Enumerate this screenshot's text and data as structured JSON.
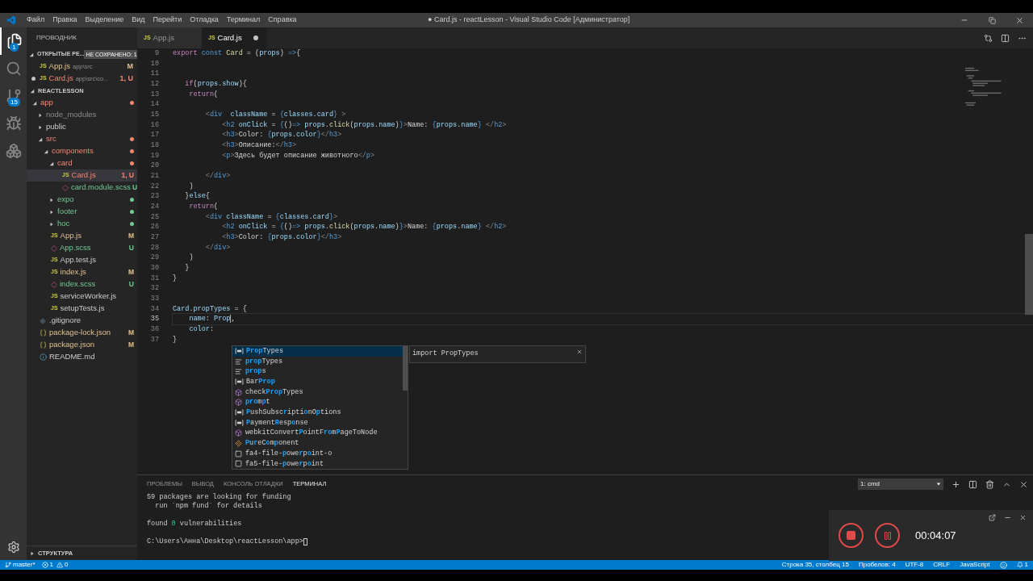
{
  "menu": [
    "Файл",
    "Правка",
    "Выделение",
    "Вид",
    "Перейти",
    "Отладка",
    "Терминал",
    "Справка"
  ],
  "window": {
    "title": "● Card.js - reactLesson - Visual Studio Code [Администратор]"
  },
  "activity": [
    {
      "kind": "files",
      "badge": "1",
      "selected": true
    },
    {
      "kind": "search",
      "selected": false
    },
    {
      "kind": "git",
      "badge": "15",
      "selected": false
    },
    {
      "kind": "debug",
      "selected": false
    },
    {
      "kind": "extensions",
      "selected": false
    }
  ],
  "sidebar": {
    "title": "ПРОВОДНИК",
    "open_editors": {
      "title": "ОТКРЫТЫЕ РЕ...",
      "badge": "НЕ СОХРАНЕНО: 1",
      "items": [
        {
          "icon": "JS",
          "name": "App.js",
          "path": "app\\src",
          "status": "M",
          "color": "#e2c08d",
          "dirty": false
        },
        {
          "icon": "JS",
          "name": "Card.js",
          "path": "app\\src\\co...",
          "status": "1, U",
          "color": "#f48771",
          "dirty": true
        }
      ]
    },
    "project": "REACTLESSON",
    "tree": [
      {
        "name": "app",
        "kind": "folder",
        "expanded": true,
        "color": "#f48771",
        "dot": true,
        "selected": false,
        "children": [
          {
            "name": "node_modules",
            "kind": "folder",
            "expanded": false,
            "ignored": true,
            "dot": false,
            "selected": false
          },
          {
            "name": "public",
            "kind": "folder",
            "expanded": false,
            "ignored": false,
            "dot": false,
            "selected": false
          },
          {
            "name": "src",
            "kind": "folder",
            "expanded": true,
            "color": "#f48771",
            "dot": true,
            "selected": false,
            "children": [
              {
                "name": "components",
                "kind": "folder",
                "expanded": true,
                "color": "#f48771",
                "dot": true,
                "selected": false,
                "children": [
                  {
                    "name": "card",
                    "kind": "folder",
                    "expanded": true,
                    "color": "#f48771",
                    "dot": true,
                    "selected": false,
                    "children": [
                      {
                        "name": "Card.js",
                        "kind": "js",
                        "icon": "JS",
                        "status": "1, U",
                        "color": "#f48771",
                        "selected": true
                      },
                      {
                        "name": "card.module.scss",
                        "kind": "scss",
                        "status": "U",
                        "color": "#73c991",
                        "selected": false
                      }
                    ]
                  },
                  {
                    "name": "expo",
                    "kind": "folder",
                    "expanded": false,
                    "color": "#73c991",
                    "dot": true,
                    "selected": false
                  },
                  {
                    "name": "footer",
                    "kind": "folder",
                    "expanded": false,
                    "color": "#73c991",
                    "dot": true,
                    "selected": false
                  },
                  {
                    "name": "hoc",
                    "kind": "folder",
                    "expanded": false,
                    "color": "#73c991",
                    "dot": true,
                    "selected": false
                  }
                ]
              },
              {
                "name": "App.js",
                "kind": "js",
                "icon": "JS",
                "status": "M",
                "color": "#e2c08d",
                "selected": false
              },
              {
                "name": "App.scss",
                "kind": "scss",
                "status": "U",
                "color": "#73c991",
                "selected": false
              },
              {
                "name": "App.test.js",
                "kind": "js",
                "icon": "JS",
                "selected": false
              },
              {
                "name": "index.js",
                "kind": "js",
                "icon": "JS",
                "status": "M",
                "color": "#e2c08d",
                "selected": false
              },
              {
                "name": "index.scss",
                "kind": "scss",
                "status": "U",
                "color": "#73c991",
                "selected": false
              },
              {
                "name": "serviceWorker.js",
                "kind": "js",
                "icon": "JS",
                "selected": false
              },
              {
                "name": "setupTests.js",
                "kind": "js",
                "icon": "JS",
                "selected": false
              }
            ]
          }
        ]
      },
      {
        "name": ".gitignore",
        "kind": "git",
        "selected": false
      },
      {
        "name": "package-lock.json",
        "kind": "json",
        "status": "M",
        "color": "#e2c08d",
        "selected": false
      },
      {
        "name": "package.json",
        "kind": "json",
        "status": "M",
        "color": "#e2c08d",
        "selected": false
      },
      {
        "name": "README.md",
        "kind": "info",
        "selected": false
      }
    ],
    "outline": "СТРУКТУРА"
  },
  "tabs": [
    {
      "icon": "JS",
      "label": "App.js",
      "selected": false,
      "dirty": false
    },
    {
      "icon": "JS",
      "label": "Card.js",
      "selected": true,
      "dirty": true
    }
  ],
  "code": [
    {
      "n": "9",
      "current": false,
      "text": "export const Card = (props) =>{"
    },
    {
      "n": "10",
      "current": false
    },
    {
      "n": "11",
      "current": false
    },
    {
      "n": "12",
      "current": false,
      "text": "   if(props.show){"
    },
    {
      "n": "13",
      "current": false,
      "text": "    return("
    },
    {
      "n": "14",
      "current": false
    },
    {
      "n": "15",
      "current": false,
      "text": "        <div  className = {classes.card} >"
    },
    {
      "n": "16",
      "current": false,
      "text": "            <h2 onClick = {()=> props.click(props.name)}>Name: {props.name} </h2>"
    },
    {
      "n": "17",
      "current": false,
      "text": "            <h3>Color: {props.color}</h3>"
    },
    {
      "n": "18",
      "current": false,
      "text": "            <h3>Описание:</h3>"
    },
    {
      "n": "19",
      "current": false,
      "text": "            <p>Здесь будет описание животного</p>"
    },
    {
      "n": "20",
      "current": false
    },
    {
      "n": "21",
      "current": false,
      "text": "        </div>"
    },
    {
      "n": "22",
      "current": false,
      "text": "    )"
    },
    {
      "n": "23",
      "current": false,
      "text": "   }else{"
    },
    {
      "n": "24",
      "current": false,
      "text": "    return("
    },
    {
      "n": "25",
      "current": false,
      "text": "        <div className = {classes.card}>"
    },
    {
      "n": "26",
      "current": false,
      "text": "            <h2 onClick = {()=> props.click(props.name)}>Name: {props.name} </h2>"
    },
    {
      "n": "27",
      "current": false,
      "text": "            <h3>Color: {props.color}</h3>"
    },
    {
      "n": "28",
      "current": false,
      "text": "        </div>"
    },
    {
      "n": "29",
      "current": false,
      "text": "    )"
    },
    {
      "n": "30",
      "current": false,
      "text": "   }"
    },
    {
      "n": "31",
      "current": false,
      "text": "}"
    },
    {
      "n": "32",
      "current": false
    },
    {
      "n": "33",
      "current": false
    },
    {
      "n": "34",
      "current": false,
      "text": "Card.propTypes = {"
    },
    {
      "n": "35",
      "current": true,
      "text": "    name: Prop,"
    },
    {
      "n": "36",
      "current": false,
      "text": "    color:"
    },
    {
      "n": "37",
      "current": false,
      "text": "}"
    }
  ],
  "suggest": {
    "items": [
      {
        "kind": "class",
        "selected": true,
        "label": "PropTypes"
      },
      {
        "kind": "field",
        "selected": false,
        "label": "propTypes"
      },
      {
        "kind": "field",
        "selected": false,
        "label": "props"
      },
      {
        "kind": "class",
        "selected": false,
        "label": "BarProp"
      },
      {
        "kind": "method",
        "selected": false,
        "label": "checkPropTypes"
      },
      {
        "kind": "method",
        "selected": false,
        "label": "prompt"
      },
      {
        "kind": "class",
        "selected": false,
        "label": "PushSubscriptionOptions"
      },
      {
        "kind": "class",
        "selected": false,
        "label": "PaymentResponse"
      },
      {
        "kind": "method",
        "selected": false,
        "label": "webkitConvertPointFromPageToNode"
      },
      {
        "kind": "component",
        "selected": false,
        "label": "PureComponent"
      },
      {
        "kind": "file",
        "selected": false,
        "label": "fa4-file-powerpoint-o"
      },
      {
        "kind": "file",
        "selected": false,
        "label": "fa5-file-powerpoint"
      }
    ],
    "detail": "import PropTypes"
  },
  "panel": {
    "tabs": [
      {
        "label": "ПРОБЛЕМЫ",
        "selected": false
      },
      {
        "label": "ВЫВОД",
        "selected": false
      },
      {
        "label": "КОНСОЛЬ ОТЛАДКИ",
        "selected": false
      },
      {
        "label": "ТЕРМИНАЛ",
        "selected": true
      }
    ],
    "terminal_select": "1: cmd",
    "blocks": [
      [
        "59 packages are looking for funding",
        "  run `npm fund` for details"
      ],
      [
        "found 0 vulnerabilities"
      ]
    ],
    "prompt": "C:\\Users\\Анна\\Desktop\\reactLesson\\app>"
  },
  "recorder": {
    "time": "00:04:07"
  },
  "status_bar": {
    "branch": "master*",
    "errors": "1",
    "warnings": "0",
    "right": [
      "Строка 35, столбец 15",
      "Пробелов: 4",
      "UTF-8",
      "CRLF",
      "JavaScript"
    ],
    "notifications": "1"
  }
}
